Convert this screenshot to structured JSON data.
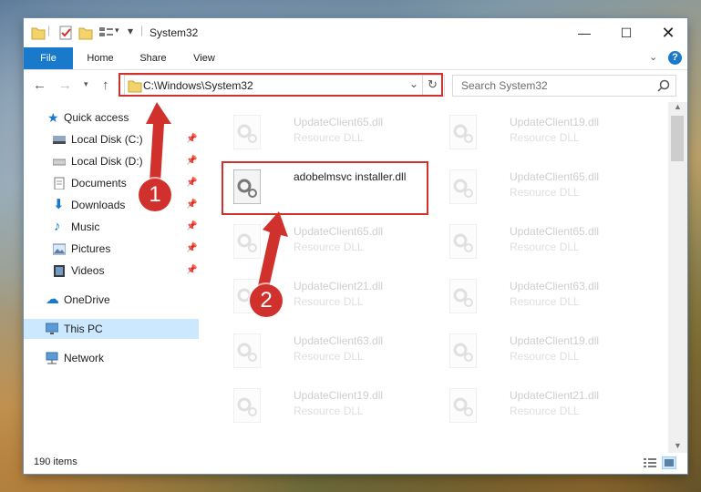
{
  "window": {
    "title": "System32"
  },
  "ribbon": {
    "tabs": [
      {
        "label": "File"
      },
      {
        "label": "Home"
      },
      {
        "label": "Share"
      },
      {
        "label": "View"
      }
    ]
  },
  "address": {
    "path": "C:\\Windows\\System32"
  },
  "search": {
    "placeholder": "Search System32"
  },
  "navpane": {
    "items": [
      {
        "label": "Quick access"
      },
      {
        "label": "Local Disk (C:)"
      },
      {
        "label": "Local Disk (D:)"
      },
      {
        "label": "Documents"
      },
      {
        "label": "Downloads"
      },
      {
        "label": "Music"
      },
      {
        "label": "Pictures"
      },
      {
        "label": "Videos"
      },
      {
        "label": "OneDrive"
      },
      {
        "label": "This PC"
      },
      {
        "label": "Network"
      }
    ]
  },
  "files": [
    {
      "name": "UpdateClient65.dll",
      "desc": "Resource DLL"
    },
    {
      "name": "UpdateClient19.dll",
      "desc": "Resource DLL"
    },
    {
      "name": "adobelmsvc installer.dll",
      "desc": ""
    },
    {
      "name": "UpdateClient65.dll",
      "desc": "Resource DLL"
    },
    {
      "name": "UpdateClient65.dll",
      "desc": "Resource DLL"
    },
    {
      "name": "UpdateClient65.dll",
      "desc": "Resource DLL"
    },
    {
      "name": "UpdateClient21.dll",
      "desc": "Resource DLL"
    },
    {
      "name": "UpdateClient63.dll",
      "desc": "Resource DLL"
    },
    {
      "name": "UpdateClient63.dll",
      "desc": "Resource DLL"
    },
    {
      "name": "UpdateClient19.dll",
      "desc": "Resource DLL"
    },
    {
      "name": "UpdateClient19.dll",
      "desc": "Resource DLL"
    },
    {
      "name": "UpdateClient21.dll",
      "desc": "Resource DLL"
    }
  ],
  "status": {
    "count": "190 items"
  },
  "annotations": {
    "step1": "1",
    "step2": "2"
  },
  "colors": {
    "accent": "#1979ca",
    "highlight": "#d0312d",
    "selected": "#cce8ff"
  },
  "icons": [
    "folder-icon",
    "properties-icon",
    "new-folder-icon",
    "customize-icon",
    "minimize-icon",
    "maximize-icon",
    "close-icon",
    "help-icon",
    "back-icon",
    "forward-icon",
    "up-icon",
    "refresh-icon",
    "search-icon",
    "star-icon",
    "drive-icon",
    "pin-icon",
    "cloud-icon",
    "pc-icon",
    "network-icon",
    "dll-file-icon",
    "details-view-icon",
    "large-icons-view-icon"
  ]
}
